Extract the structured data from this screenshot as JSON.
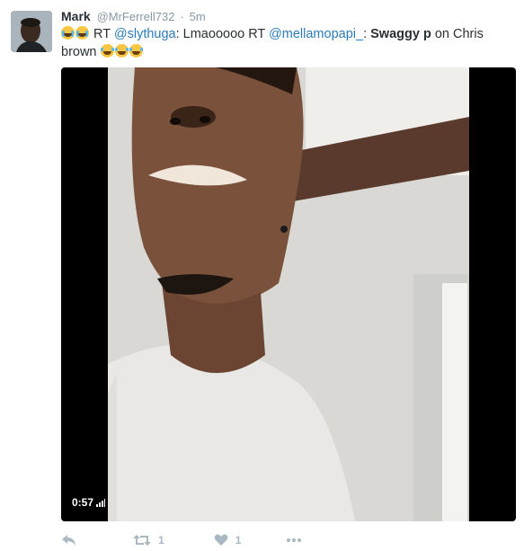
{
  "tweet": {
    "author_name": "Mark",
    "handle": "@MrFerrell732",
    "separator": "·",
    "time": "5m",
    "text": {
      "rt_prefix": "RT",
      "mention_1": "@slythuga",
      "mid_text": ": Lmaooooo RT",
      "mention_2": "@mellamopapi_",
      "after_mention": ":",
      "bold_text": "Swaggy p",
      "tail_text": "on Chris brown"
    },
    "lead_emojis": [
      "crying-face",
      "crying-face"
    ],
    "trail_emojis": [
      "tears-of-joy",
      "tears-of-joy",
      "tears-of-joy"
    ]
  },
  "video": {
    "duration": "0:57",
    "icon": "volume-bars-icon"
  },
  "actions": {
    "reply_icon": "reply-icon",
    "retweet_icon": "retweet-icon",
    "retweet_count": "1",
    "like_icon": "heart-icon",
    "like_count": "1",
    "more_icon": "more-dots-icon"
  },
  "colors": {
    "text": "#292f33",
    "meta": "#8899a6",
    "link": "#2b7bb9",
    "action_gray": "#aab8c2",
    "video_bg": "#000000"
  }
}
